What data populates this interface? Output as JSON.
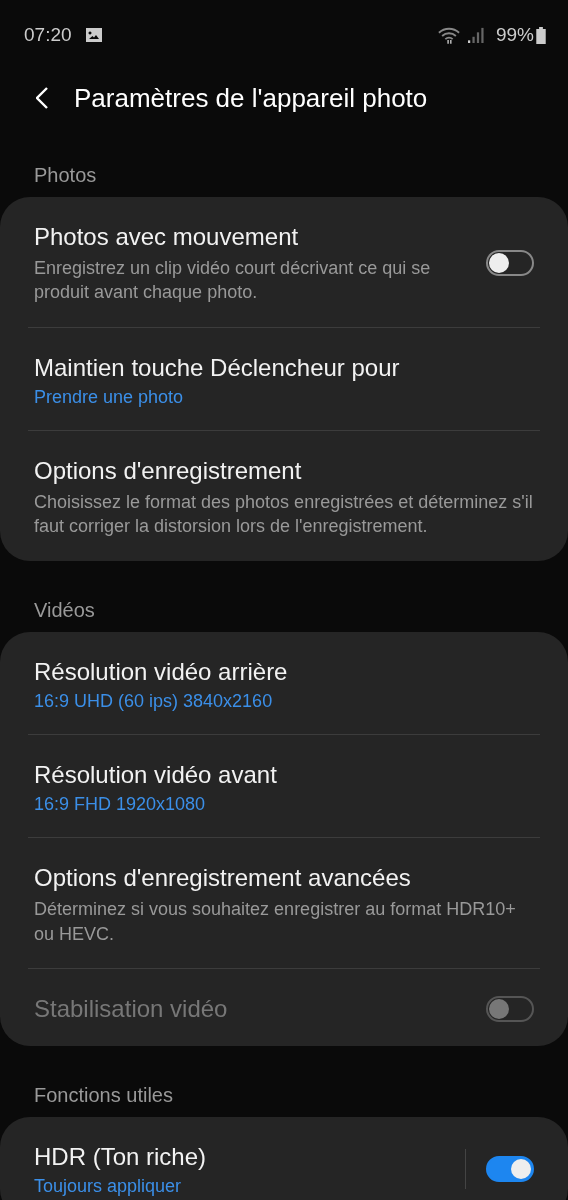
{
  "status_bar": {
    "time": "07:20",
    "battery": "99%"
  },
  "header": {
    "title": "Paramètres de l'appareil photo"
  },
  "sections": [
    {
      "title": "Photos",
      "items": [
        {
          "title": "Photos avec mouvement",
          "description": "Enregistrez un clip vidéo court décrivant ce qui se produit avant chaque photo.",
          "toggle": {
            "on": false
          }
        },
        {
          "title": "Maintien touche Déclencheur pour",
          "value": "Prendre une photo"
        },
        {
          "title": "Options d'enregistrement",
          "description": "Choisissez le format des photos enregistrées et déterminez s'il faut corriger la distorsion lors de l'enregistrement."
        }
      ]
    },
    {
      "title": "Vidéos",
      "items": [
        {
          "title": "Résolution vidéo arrière",
          "value": "16:9 UHD (60 ips) 3840x2160"
        },
        {
          "title": "Résolution vidéo avant",
          "value": "16:9 FHD 1920x1080"
        },
        {
          "title": "Options d'enregistrement avancées",
          "description": "Déterminez si vous souhaitez enregistrer au format HDR10+ ou HEVC."
        },
        {
          "title": "Stabilisation vidéo",
          "disabled": true,
          "toggle": {
            "on": false
          }
        }
      ]
    },
    {
      "title": "Fonctions utiles",
      "items": [
        {
          "title": "HDR (Ton riche)",
          "value": "Toujours appliquer",
          "split": true,
          "toggle": {
            "on": true
          }
        }
      ]
    }
  ]
}
